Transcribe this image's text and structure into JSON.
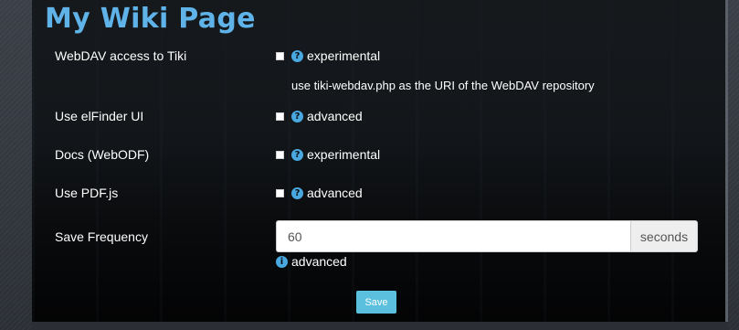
{
  "page": {
    "title": "My Wiki Page"
  },
  "settings": [
    {
      "label": "WebDAV access to Tiki",
      "tag": "experimental",
      "help": "use tiki-webdav.php as the URI of the WebDAV repository"
    },
    {
      "label": "Use elFinder UI",
      "tag": "advanced"
    },
    {
      "label": "Docs (WebODF)",
      "tag": "experimental"
    },
    {
      "label": "Use PDF.js",
      "tag": "advanced"
    }
  ],
  "save_frequency": {
    "label": "Save Frequency",
    "value": "60",
    "unit": "seconds",
    "tag": "advanced"
  },
  "actions": {
    "save_label": "Save"
  },
  "icons": {
    "help": "question-circle-icon",
    "info": "info-circle-icon"
  },
  "colors": {
    "title": "#5fb3e8",
    "accent": "#4aa8e0",
    "save_button": "#5bc0de"
  }
}
